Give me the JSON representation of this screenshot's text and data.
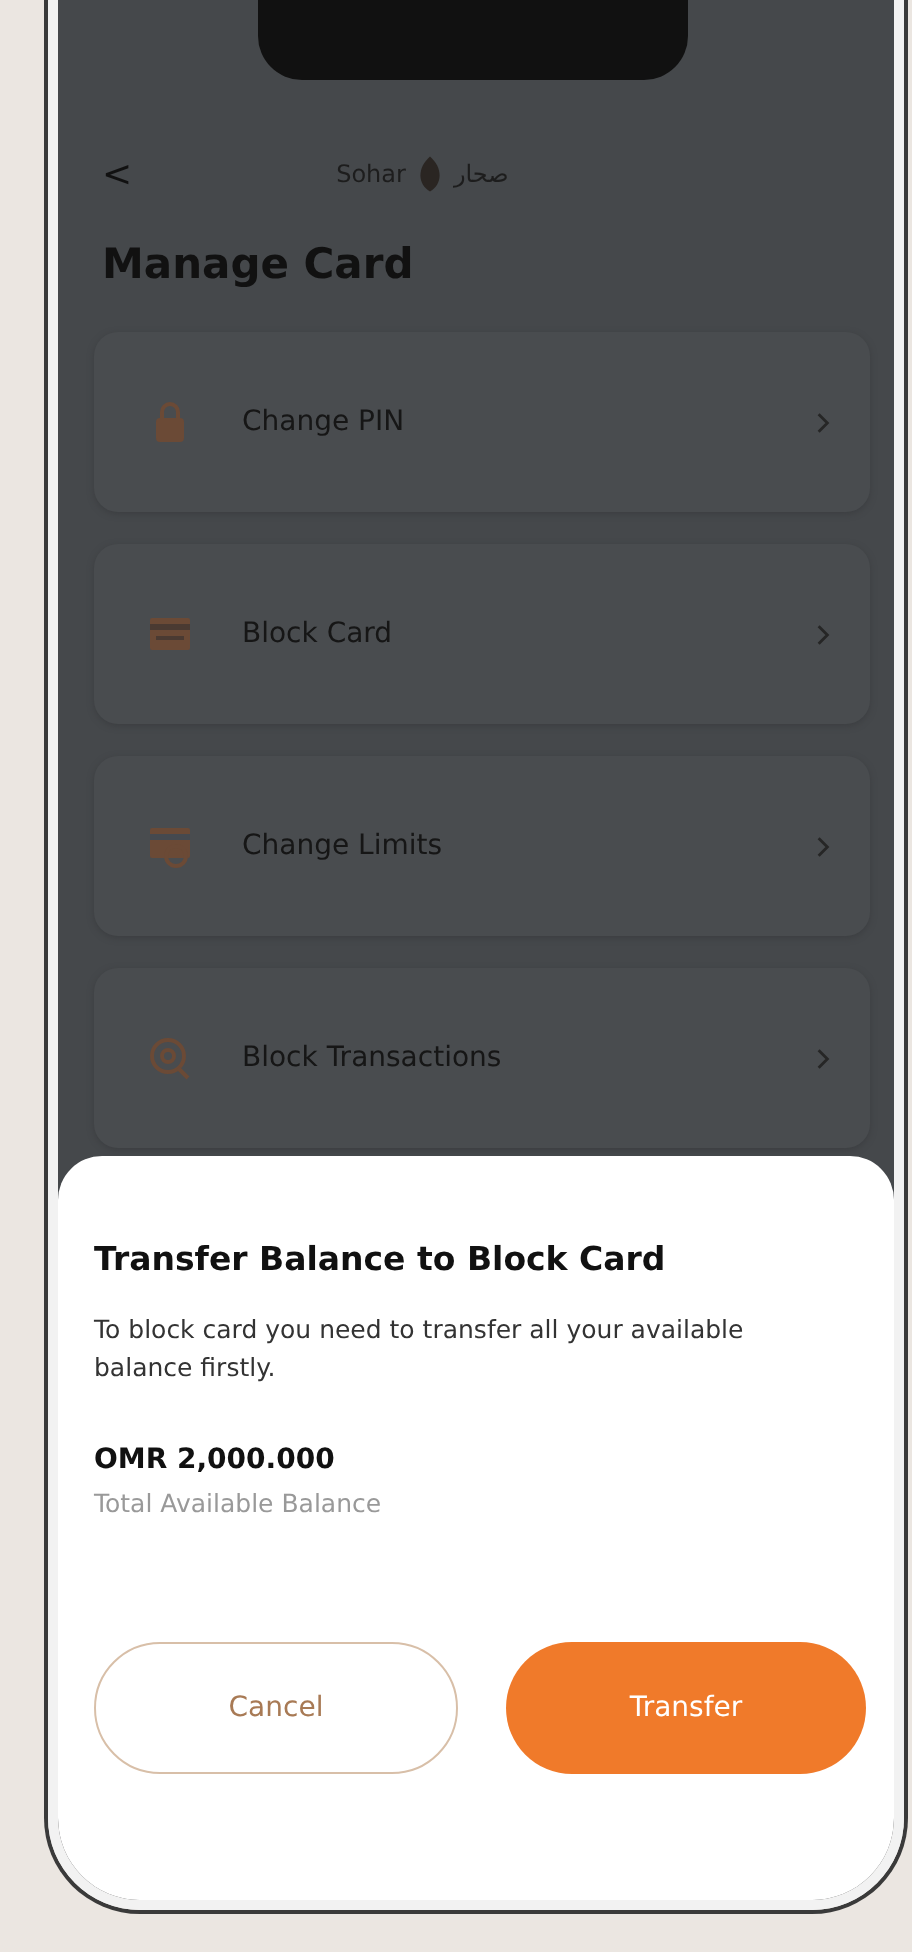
{
  "header": {
    "back": "<",
    "logo_latin": "Sohar",
    "logo_arabic": "صحار"
  },
  "title": "Manage Card",
  "menu": [
    {
      "kind": "lock",
      "label": "Change PIN"
    },
    {
      "kind": "card",
      "label": "Block Card"
    },
    {
      "kind": "limits",
      "label": "Change Limits"
    },
    {
      "kind": "search",
      "label": "Block Transactions"
    }
  ],
  "sheet": {
    "title": "Transfer Balance to Block Card",
    "message": "To block card you need to transfer all your available balance firstly.",
    "amount": "OMR 2,000.000",
    "amount_caption": "Total Available Balance",
    "buttons": [
      {
        "kind": "secondary",
        "label": "Cancel"
      },
      {
        "kind": "primary",
        "label": "Transfer"
      }
    ]
  }
}
